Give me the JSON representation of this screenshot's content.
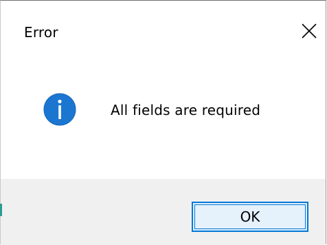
{
  "dialog": {
    "title": "Error",
    "message": "All fields are required",
    "icon": "info-icon",
    "ok_label": "OK",
    "close_icon": "close-icon"
  },
  "colors": {
    "accent": "#0078d7",
    "icon_fill": "#1b76d2",
    "footer_bg": "#f0f0f0",
    "button_bg": "#e5f1fb"
  }
}
